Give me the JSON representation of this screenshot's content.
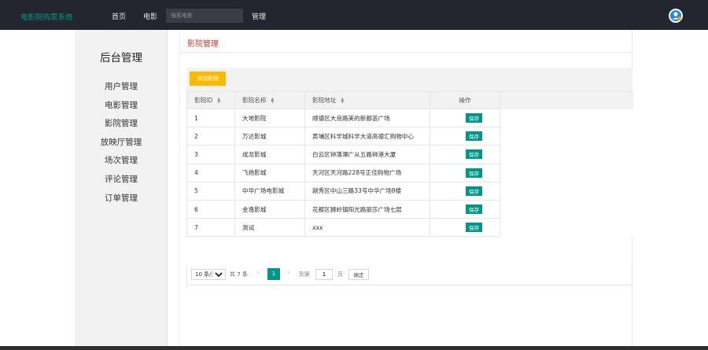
{
  "header": {
    "brand": "电影院购票系统",
    "nav": {
      "home": "首页",
      "movie": "电影",
      "manage": "管理"
    },
    "search_placeholder": "搜索电影"
  },
  "sidebar": {
    "title": "后台管理",
    "items": [
      {
        "label": "用户管理"
      },
      {
        "label": "电影管理"
      },
      {
        "label": "影院管理"
      },
      {
        "label": "放映厅管理"
      },
      {
        "label": "场次管理"
      },
      {
        "label": "评论管理"
      },
      {
        "label": "订单管理"
      }
    ]
  },
  "main": {
    "title": "影院管理",
    "add_button": "添加影院",
    "table": {
      "headers": {
        "id": "影院ID",
        "name": "影院名称",
        "address": "影院地址",
        "action": "操作"
      },
      "action_label": "保存",
      "rows": [
        {
          "id": "1",
          "name": "大地影院",
          "address": "顺德区大良路美的新都荟广场"
        },
        {
          "id": "2",
          "name": "万达影城",
          "address": "黄埔区科学城科学大道高德汇购物中心"
        },
        {
          "id": "3",
          "name": "成龙影城",
          "address": "白云区钟落潭广从五路钟港大厦"
        },
        {
          "id": "4",
          "name": "飞扬影城",
          "address": "天河区天河路228号正佳购物广场"
        },
        {
          "id": "5",
          "name": "中华广场电影城",
          "address": "越秀区中山三路33号中华广场8楼"
        },
        {
          "id": "6",
          "name": "金逸影城",
          "address": "花都区狮岭镇阳光路丽莎广场七层"
        },
        {
          "id": "7",
          "name": "测试",
          "address": "xxx"
        }
      ]
    },
    "pager": {
      "page_size": "10 条/页",
      "total": "共 7 条",
      "current_page": "1",
      "goto_label": "到第",
      "goto_value": "1",
      "page_unit": "页",
      "confirm": "确定"
    }
  },
  "colors": {
    "topbar": "#23262e",
    "brand": "#009688",
    "accent": "#009688",
    "add_button": "#ffb800",
    "panel_title": "#c0392b"
  },
  "icons": {
    "sort": "sort-icon",
    "prev": "chevron-left-icon",
    "next": "chevron-right-icon",
    "avatar": "user-avatar-icon"
  }
}
